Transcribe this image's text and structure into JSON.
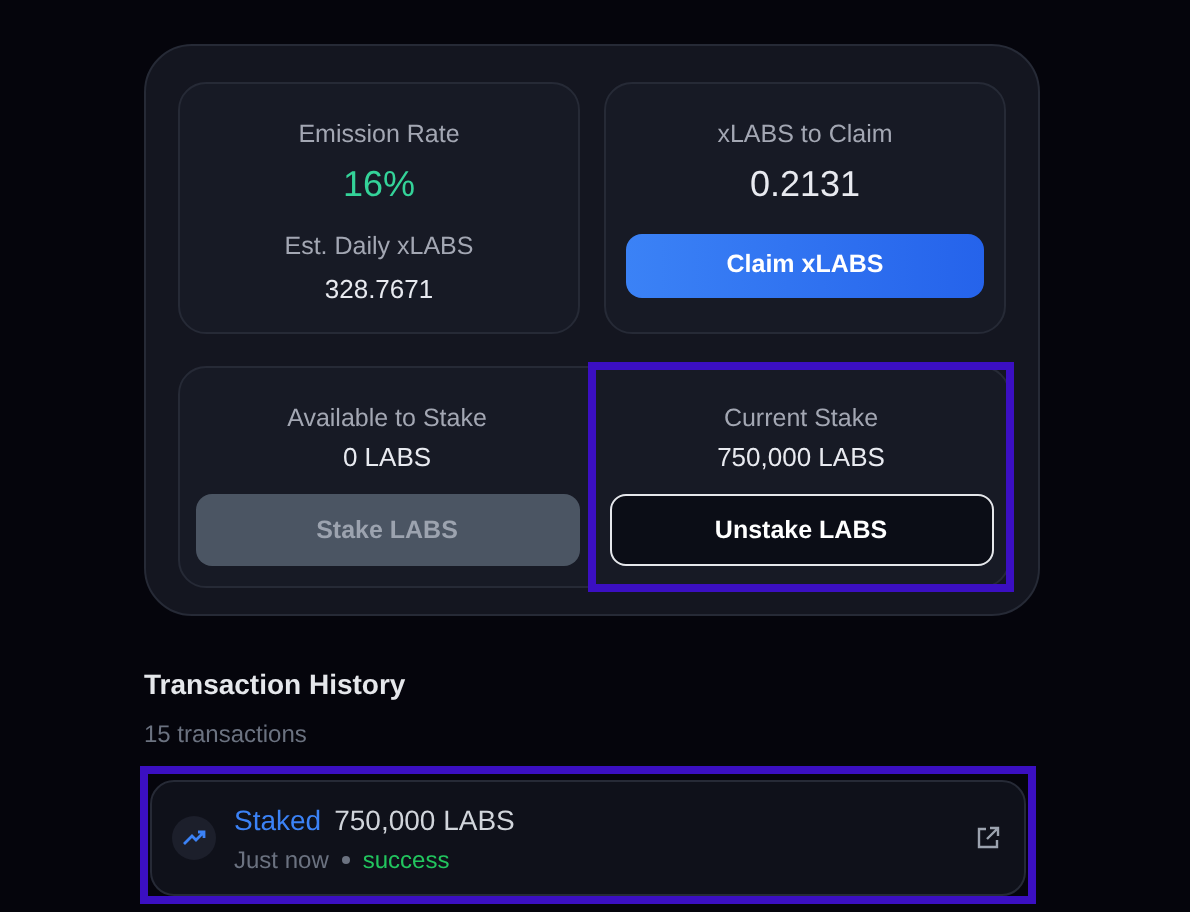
{
  "emission": {
    "label": "Emission Rate",
    "value": "16%",
    "daily_label": "Est. Daily xLABS",
    "daily_value": "328.7671"
  },
  "claim": {
    "label": "xLABS to Claim",
    "value": "0.2131",
    "button": "Claim xLABS",
    "disabled": false
  },
  "stake_panels": [
    {
      "label": "Available to Stake",
      "value": "0 LABS",
      "button": "Stake LABS",
      "kind": "stake",
      "disabled": true,
      "highlighted": false
    },
    {
      "label": "Current Stake",
      "value": "750,000 LABS",
      "button": "Unstake LABS",
      "kind": "unstake",
      "disabled": false,
      "highlighted": true
    }
  ],
  "history": {
    "title": "Transaction History",
    "count": "15 transactions",
    "transactions": [
      {
        "action": "Staked",
        "amount": "750,000 LABS",
        "time": "Just now",
        "status": "success",
        "highlighted": true
      }
    ]
  }
}
